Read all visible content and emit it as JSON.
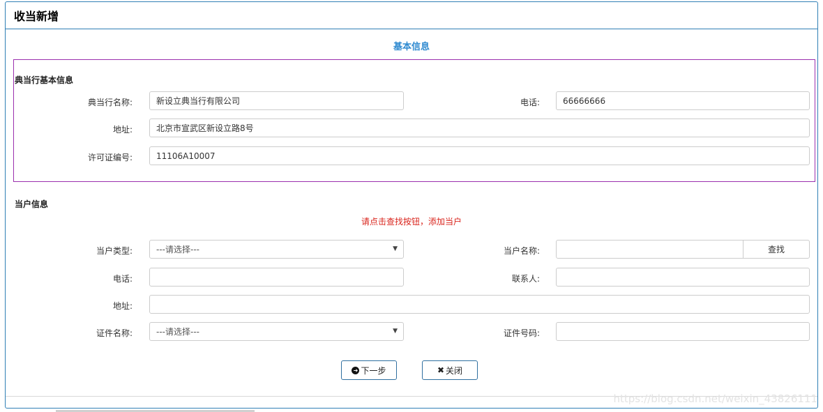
{
  "panel": {
    "title": "收当新增"
  },
  "section": {
    "title": "基本信息"
  },
  "pawnshop": {
    "group_label": "典当行基本信息",
    "name_label": "典当行名称:",
    "name_value": "新设立典当行有限公司",
    "phone_label": "电话:",
    "phone_value": "66666666",
    "address_label": "地址:",
    "address_value": "北京市宣武区新设立路8号",
    "license_label": "许可证编号:",
    "license_value": "11106A10007"
  },
  "customer": {
    "group_label": "当户信息",
    "hint": "请点击查找按钮，添加当户",
    "type_label": "当户类型:",
    "type_value": "---请选择---",
    "name_label": "当户名称:",
    "name_value": "",
    "find_label": "查找",
    "phone_label": "电话:",
    "phone_value": "",
    "contact_label": "联系人:",
    "contact_value": "",
    "address_label": "地址:",
    "address_value": "",
    "cert_type_label": "证件名称:",
    "cert_type_value": "---请选择---",
    "cert_no_label": "证件号码:",
    "cert_no_value": ""
  },
  "actions": {
    "next_label": "下一步",
    "close_label": "关闭"
  },
  "watermark": "https://blog.csdn.net/weixin_43826111",
  "icons": {
    "next": "arrow-circle-icon",
    "close": "close-icon",
    "dropdown": "caret-down-icon"
  }
}
